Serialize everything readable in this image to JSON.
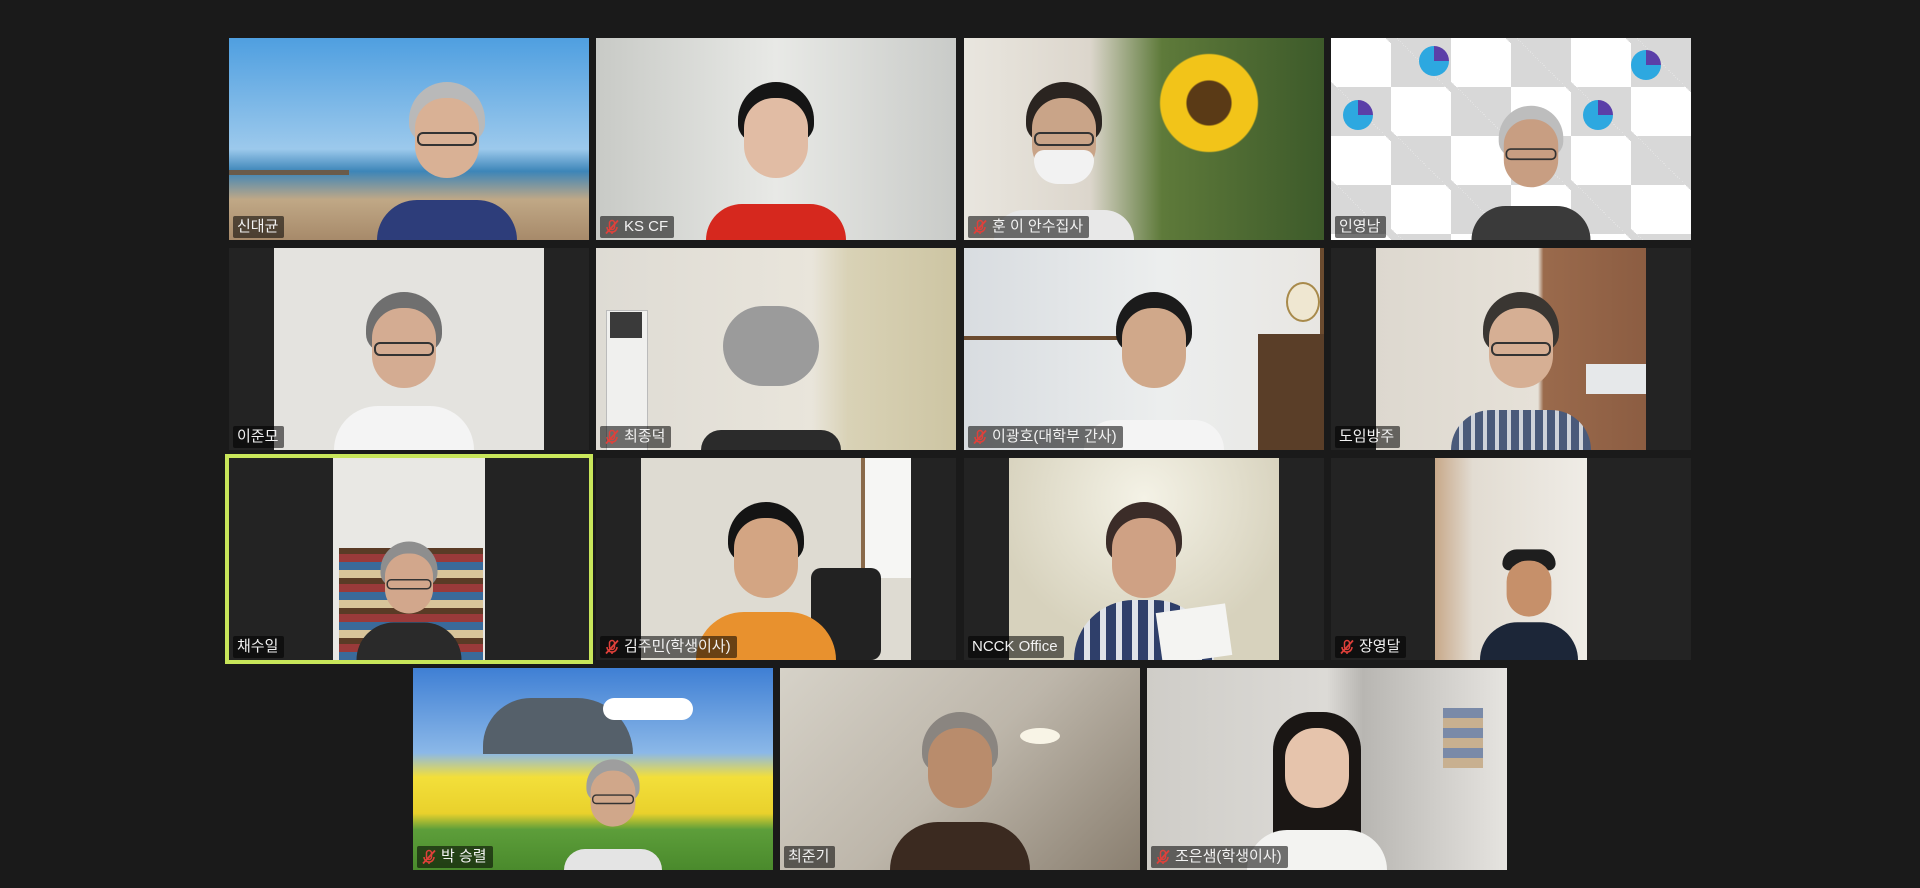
{
  "colors": {
    "background": "#1a1a1a",
    "active_speaker_border": "#c8e65a",
    "muted_icon": "#e0403a"
  },
  "participants": [
    {
      "name": "신대균",
      "muted": false,
      "bg": "beach",
      "active": false
    },
    {
      "name": "KS CF",
      "muted": true,
      "bg": "white-wall",
      "active": false
    },
    {
      "name": "훈 이 안수집사",
      "muted": true,
      "bg": "sunflower",
      "active": false
    },
    {
      "name": "인영남",
      "muted": false,
      "bg": "logo-pattern",
      "active": false
    },
    {
      "name": "이준모",
      "muted": false,
      "bg": "plain-room",
      "active": false
    },
    {
      "name": "최종덕",
      "muted": true,
      "bg": "wallpaper-room",
      "active": false
    },
    {
      "name": "이광호(대학부 간사)",
      "muted": true,
      "bg": "room-clock",
      "active": false
    },
    {
      "name": "도임방주",
      "muted": false,
      "bg": "wood-room",
      "active": false
    },
    {
      "name": "채수일",
      "muted": false,
      "bg": "bookshelf",
      "active": true
    },
    {
      "name": "김주민(학생이사)",
      "muted": true,
      "bg": "room-window",
      "active": false
    },
    {
      "name": "NCCK Office",
      "muted": false,
      "bg": "office",
      "active": false
    },
    {
      "name": "장영달",
      "muted": true,
      "bg": "hallway",
      "active": false
    },
    {
      "name": "박 승렬",
      "muted": true,
      "bg": "canola-mountain",
      "active": false
    },
    {
      "name": "최준기",
      "muted": false,
      "bg": "dim-room",
      "active": false
    },
    {
      "name": "조은샘(학생이사)",
      "muted": true,
      "bg": "closet-room",
      "active": false
    }
  ]
}
